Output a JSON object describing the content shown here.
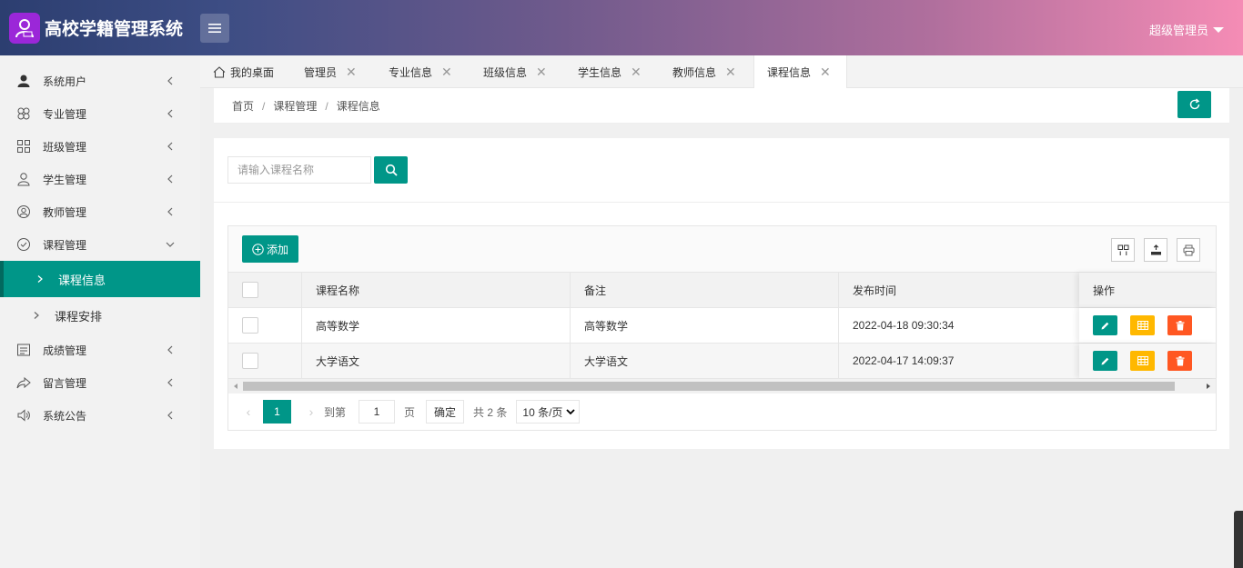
{
  "app": {
    "title": "高校学籍管理系统",
    "user": "超级管理员"
  },
  "sidebar": {
    "items": [
      {
        "label": "系统用户",
        "icon": "user-icon"
      },
      {
        "label": "专业管理",
        "icon": "clover-icon"
      },
      {
        "label": "班级管理",
        "icon": "grid-icon"
      },
      {
        "label": "学生管理",
        "icon": "student-icon"
      },
      {
        "label": "教师管理",
        "icon": "teacher-icon"
      },
      {
        "label": "课程管理",
        "icon": "check-circle-icon",
        "expanded": true
      },
      {
        "label": "成绩管理",
        "icon": "chart-table-icon"
      },
      {
        "label": "留言管理",
        "icon": "share-icon"
      },
      {
        "label": "系统公告",
        "icon": "speaker-icon"
      }
    ],
    "sub_items": [
      {
        "label": "课程信息",
        "active": true
      },
      {
        "label": "课程安排",
        "active": false
      }
    ]
  },
  "tabs": [
    {
      "label": "我的桌面",
      "closable": false
    },
    {
      "label": "管理员",
      "closable": true
    },
    {
      "label": "专业信息",
      "closable": true
    },
    {
      "label": "班级信息",
      "closable": true
    },
    {
      "label": "学生信息",
      "closable": true
    },
    {
      "label": "教师信息",
      "closable": true
    },
    {
      "label": "课程信息",
      "closable": true,
      "active": true
    }
  ],
  "breadcrumb": [
    "首页",
    "课程管理",
    "课程信息"
  ],
  "search": {
    "placeholder": "请输入课程名称"
  },
  "toolbar": {
    "add_label": "添加"
  },
  "table": {
    "columns": [
      "课程名称",
      "备注",
      "发布时间",
      "操作"
    ],
    "rows": [
      {
        "name": "高等数学",
        "note": "高等数学",
        "time": "2022-04-18 09:30:34"
      },
      {
        "name": "大学语文",
        "note": "大学语文",
        "time": "2022-04-17 14:09:37"
      }
    ]
  },
  "pager": {
    "current": "1",
    "goto_label": "到第",
    "goto_value": "1",
    "page_unit": "页",
    "confirm": "确定",
    "total": "共 2 条",
    "page_size": "10 条/页"
  },
  "colors": {
    "primary": "#009688",
    "warn": "#ffb800",
    "danger": "#ff5722"
  }
}
